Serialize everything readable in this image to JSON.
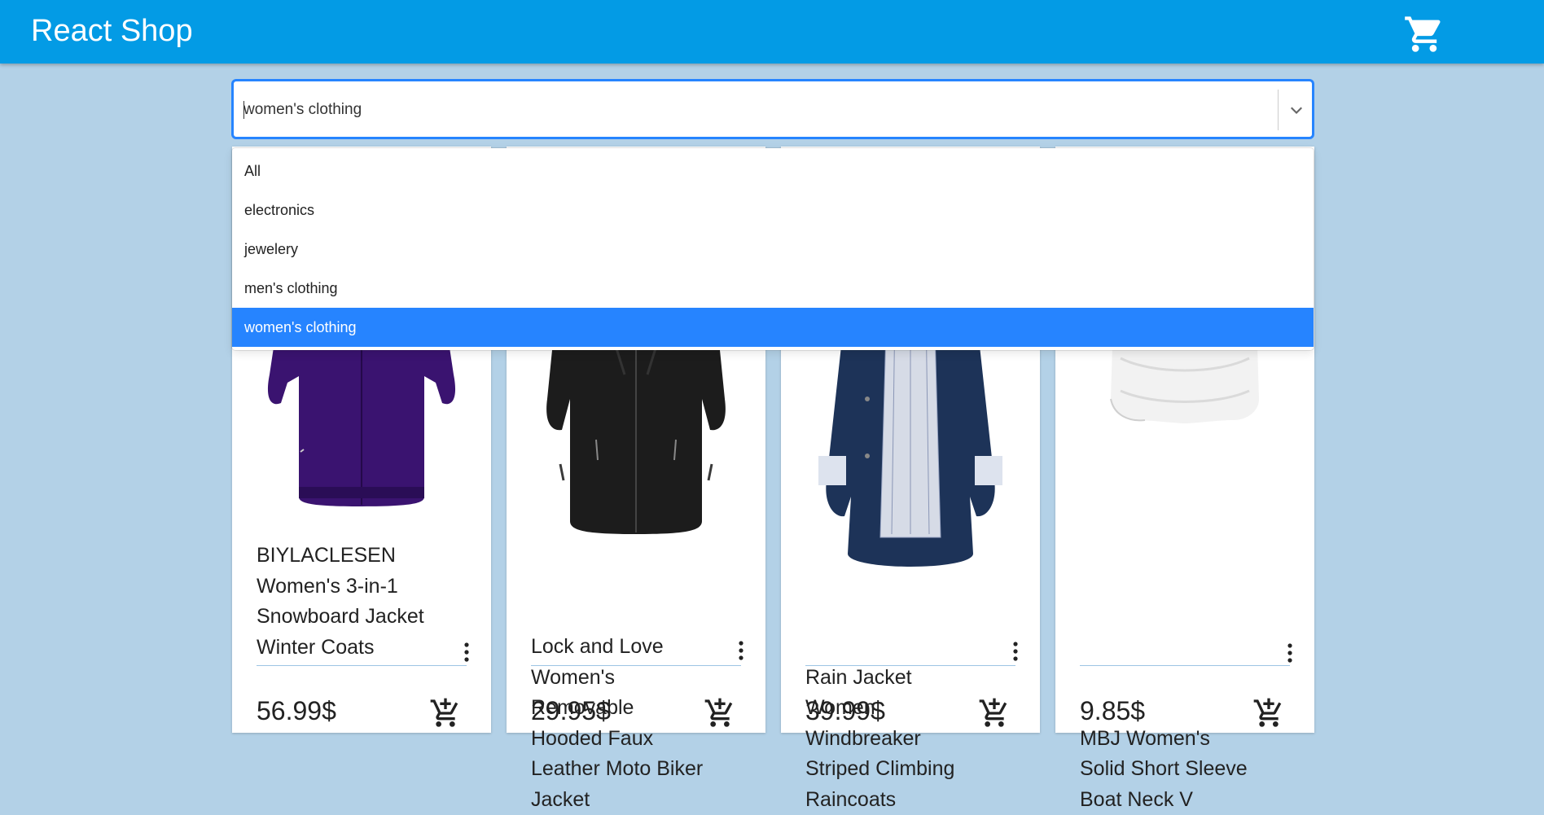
{
  "appbar": {
    "title": "React Shop",
    "cart_icon": "cart-icon",
    "color": "#039be5"
  },
  "category_select": {
    "value": "women's clothing",
    "options": [
      "All",
      "electronics",
      "jewelery",
      "men's clothing",
      "women's clothing"
    ],
    "selected_index": 4,
    "accent_color": "#2684ff"
  },
  "products": [
    {
      "title_lines": [
        "BIYLACLESEN",
        "Women's 3-in-1",
        "Snowboard Jacket",
        "Winter Coats"
      ],
      "price": "56.99$"
    },
    {
      "title_lines": [
        "Lock and Love",
        "Women's",
        "Removable",
        "Hooded Faux",
        "Leather Moto Biker",
        "Jacket"
      ],
      "price": "29.95$"
    },
    {
      "title_lines": [
        "Rain Jacket",
        "Women",
        "Windbreaker",
        "Striped Climbing",
        "Raincoats"
      ],
      "price": "39.99$"
    },
    {
      "title_lines": [
        "MBJ Women's",
        "Solid Short Sleeve",
        "Boat Neck V"
      ],
      "price": "9.85$"
    }
  ],
  "colors": {
    "background": "#b3d1e7",
    "divider": "#9cc4e4"
  }
}
